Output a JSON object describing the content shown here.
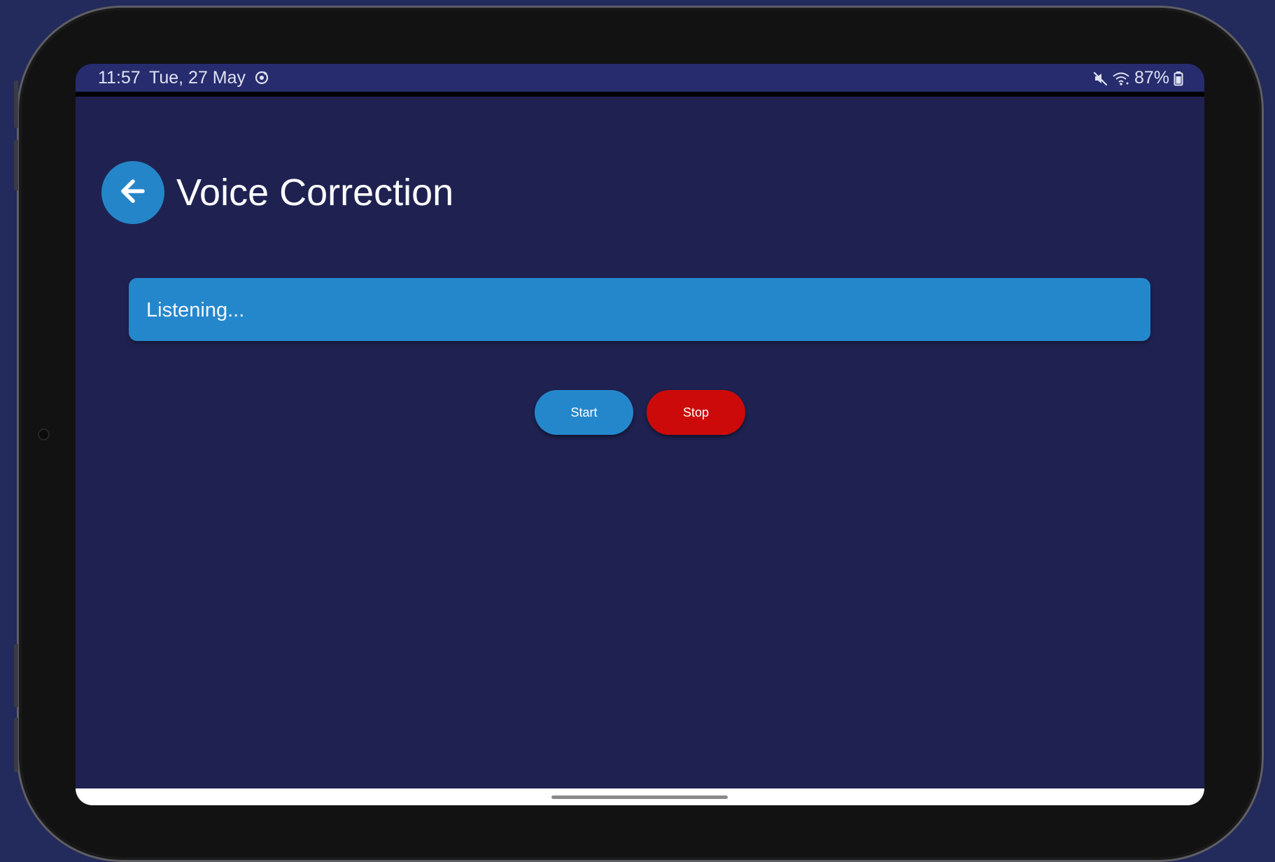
{
  "status_bar": {
    "time": "11:57",
    "date": "Tue, 27 May",
    "battery": "87%",
    "icons": [
      "sync-icon",
      "mute-icon",
      "wifi-icon",
      "battery-icon"
    ]
  },
  "header": {
    "title": "Voice Correction",
    "back_icon": "arrow-left-icon"
  },
  "main": {
    "transcript_text": "Listening...",
    "start_label": "Start",
    "stop_label": "Stop"
  },
  "colors": {
    "background": "#1f2251",
    "status_bar": "#262c6d",
    "accent_blue": "#2587cb",
    "stop_red": "#cc0a0a",
    "device_background": "#232a5c"
  }
}
